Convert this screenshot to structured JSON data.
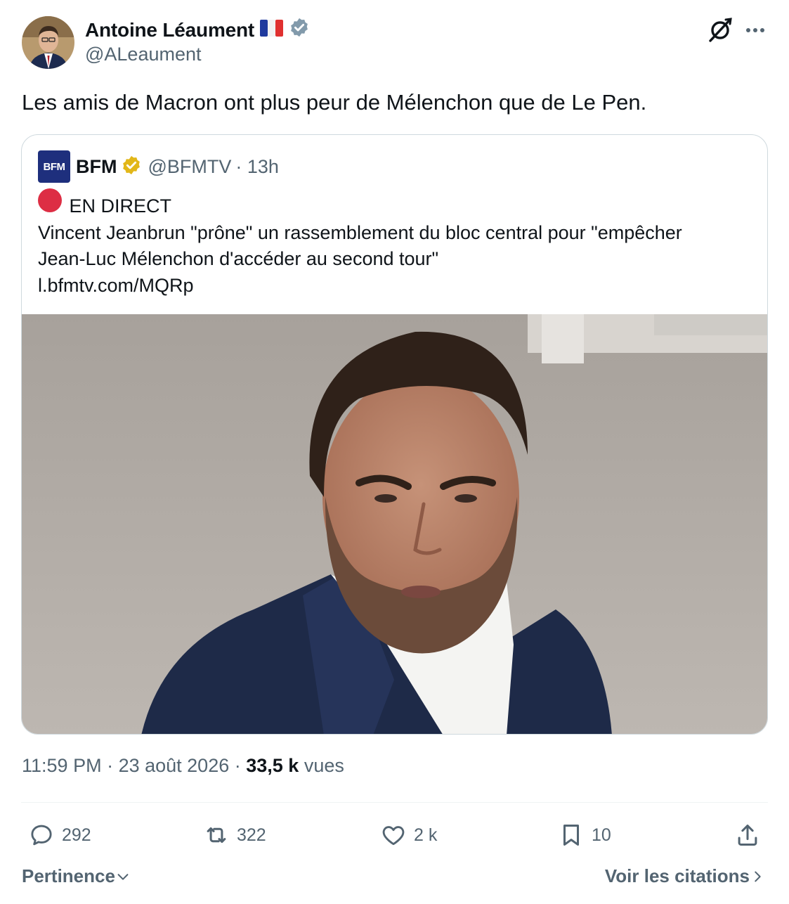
{
  "author": {
    "display_name": "Antoine Léaument",
    "handle": "@ALeaument",
    "flag": "🇫🇷",
    "verified_badge": "verified-badge-icon"
  },
  "tweet": {
    "text": "Les amis de Macron ont plus peur de Mélenchon que de Le Pen."
  },
  "quoted": {
    "logo_text": "BFM",
    "name": "BFM",
    "handle": "@BFMTV",
    "time": "· 13h",
    "live_label": "EN DIRECT",
    "line1": "Vincent Jeanbrun \"prône\" un rassemblement du bloc central pour \"empêcher",
    "line2": "Jean-Luc Mélenchon d'accéder au second tour\"",
    "link": "l.bfmtv.com/MQRp",
    "image_icon": "photo-of-man-in-suit"
  },
  "meta": {
    "time": "11:59 PM",
    "sep1": " · ",
    "date": "23 août 2026",
    "sep2": " · ",
    "views_count": "33,5 k",
    "views_label": " vues"
  },
  "actions": {
    "replies": "292",
    "reposts": "322",
    "likes": "2 k",
    "bookmarks": "10"
  },
  "footer": {
    "sort_label": "Pertinence",
    "quotes_label": "Voir les citations"
  },
  "colors": {
    "text": "#0f1419",
    "secondary": "#536471",
    "border": "#cfd9de",
    "verified_blue": "#829aab",
    "verified_gold": "#e2b719",
    "bfm_blue": "#1e2f7d",
    "live_red": "#dd2e44"
  }
}
